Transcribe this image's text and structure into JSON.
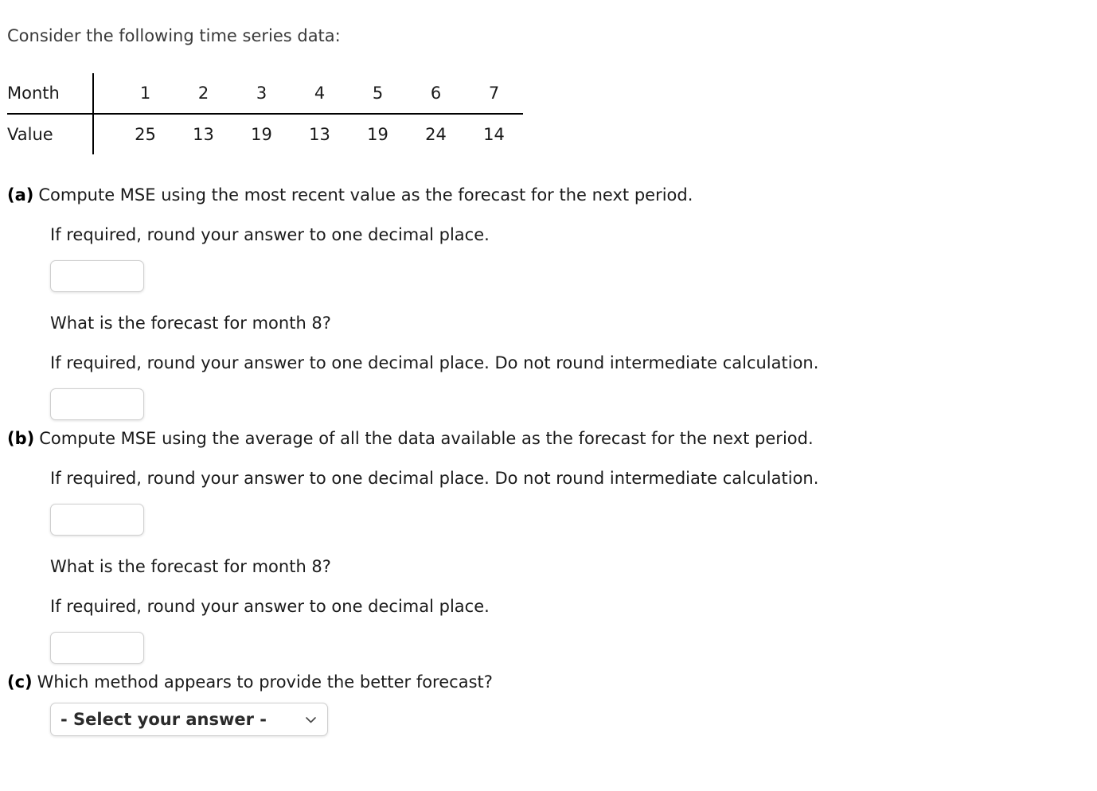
{
  "intro": "Consider the following time series data:",
  "table": {
    "row_labels": [
      "Month",
      "Value"
    ],
    "months": [
      "1",
      "2",
      "3",
      "4",
      "5",
      "6",
      "7"
    ],
    "values": [
      "25",
      "13",
      "19",
      "13",
      "19",
      "24",
      "14"
    ]
  },
  "questions": [
    {
      "marker": "(a)",
      "prompt": "Compute MSE using the most recent value as the forecast for the next period.",
      "lines": [
        {
          "kind": "text",
          "text": "If required, round your answer to one decimal place."
        },
        {
          "kind": "input",
          "value": "",
          "placeholder": ""
        },
        {
          "kind": "text",
          "text": "What is the forecast for month 8?"
        },
        {
          "kind": "text",
          "text": "If required, round your answer to one decimal place. Do not round intermediate calculation."
        },
        {
          "kind": "input",
          "value": "",
          "placeholder": ""
        }
      ]
    },
    {
      "marker": "(b)",
      "prompt": "Compute MSE using the average of all the data available as the forecast for the next period.",
      "lines": [
        {
          "kind": "text",
          "text": "If required, round your answer to one decimal place. Do not round intermediate calculation."
        },
        {
          "kind": "input",
          "value": "",
          "placeholder": ""
        },
        {
          "kind": "text",
          "text": "What is the forecast for month 8?"
        },
        {
          "kind": "text",
          "text": "If required, round your answer to one decimal place."
        },
        {
          "kind": "input",
          "value": "",
          "placeholder": ""
        }
      ]
    },
    {
      "marker": "(c)",
      "prompt": "Which method appears to provide the better forecast?",
      "lines": [
        {
          "kind": "select",
          "value": "- Select your answer -",
          "icon": "chevron-down-icon"
        }
      ]
    }
  ]
}
